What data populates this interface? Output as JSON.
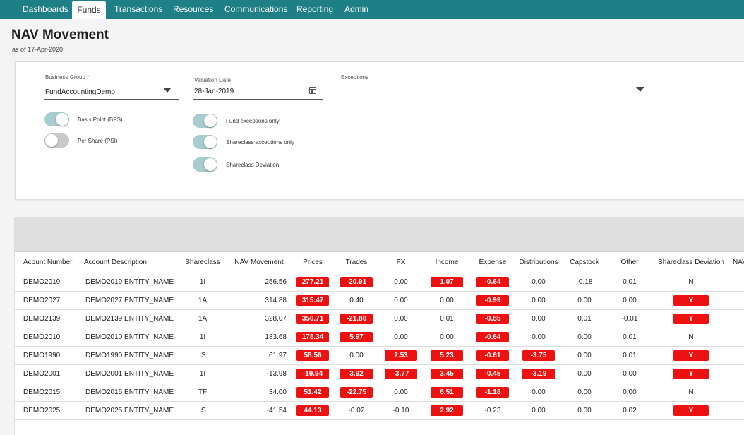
{
  "nav": {
    "tabs": [
      {
        "label": "Dashboards"
      },
      {
        "label": "Funds"
      },
      {
        "label": "Transactions"
      },
      {
        "label": "Resources"
      },
      {
        "label": "Communications"
      },
      {
        "label": "Reporting"
      },
      {
        "label": "Admin"
      }
    ],
    "active_tab": "Funds"
  },
  "header": {
    "title": "NAV Movement",
    "as_of": "as of 17-Apr-2020"
  },
  "filters": {
    "business_group": {
      "label": "Business Group *",
      "value": "FundAccountingDemo"
    },
    "valuation_date": {
      "label": "Valuation Date",
      "value": "28-Jan-2019"
    },
    "exceptions": {
      "label": "Exceptions",
      "value": ""
    },
    "toggles": [
      {
        "label": "Basis Point (BPS)",
        "on": true
      },
      {
        "label": "Per Share (PSI)",
        "on": false
      },
      {
        "label": "Fund exceptions only",
        "on": true
      },
      {
        "label": "Shareclass exceptions only",
        "on": true
      },
      {
        "label": "Shareclass Deviation",
        "on": true
      }
    ]
  },
  "table": {
    "columns": [
      "Acount Number",
      "Account Description",
      "Shareclass",
      "NAV Movement",
      "Prices",
      "Trades",
      "FX",
      "Income",
      "Expense",
      "Distributions",
      "Capstock",
      "Other",
      "Shareclass Deviation",
      "NAV"
    ],
    "rows": [
      {
        "account": "DEMO2019",
        "description": "DEMO2019 ENTITY_NAME",
        "shareclass": "1I",
        "nav_movement": "256.56",
        "prices": "277.21",
        "trades": "-20.91",
        "fx": "0.00",
        "income": "1.07",
        "expense": "-0.64",
        "distributions": "0.00",
        "capstock": "-0.18",
        "other": "0.01",
        "deviation": "N"
      },
      {
        "account": "DEMO2027",
        "description": "DEMO2027 ENTITY_NAME",
        "shareclass": "1A",
        "nav_movement": "314.88",
        "prices": "315.47",
        "trades": "0.40",
        "fx": "0.00",
        "income": "0.00",
        "expense": "-0.99",
        "distributions": "0.00",
        "capstock": "0.00",
        "other": "0.00",
        "deviation": "Y"
      },
      {
        "account": "DEMO2139",
        "description": "DEMO2139 ENTITY_NAME",
        "shareclass": "1A",
        "nav_movement": "328.07",
        "prices": "350.71",
        "trades": "-21.80",
        "fx": "0.00",
        "income": "0.01",
        "expense": "-0.85",
        "distributions": "0.00",
        "capstock": "0.01",
        "other": "-0.01",
        "deviation": "Y"
      },
      {
        "account": "DEMO2010",
        "description": "DEMO2010 ENTITY_NAME",
        "shareclass": "1I",
        "nav_movement": "183.68",
        "prices": "178.34",
        "trades": "5.97",
        "fx": "0.00",
        "income": "0.00",
        "expense": "-0.64",
        "distributions": "0.00",
        "capstock": "0.00",
        "other": "0.01",
        "deviation": "N"
      },
      {
        "account": "DEMO1990",
        "description": "DEMO1990 ENTITY_NAME",
        "shareclass": "IS",
        "nav_movement": "61.97",
        "prices": "58.56",
        "trades": "0.00",
        "fx": "2.53",
        "income": "5.23",
        "expense": "-0.61",
        "distributions": "-3.75",
        "capstock": "0.00",
        "other": "0.01",
        "deviation": "Y"
      },
      {
        "account": "DEMO2001",
        "description": "DEMO2001 ENTITY_NAME",
        "shareclass": "1I",
        "nav_movement": "-13.98",
        "prices": "-19.94",
        "trades": "3.92",
        "fx": "-3.77",
        "income": "3.45",
        "expense": "-0.45",
        "distributions": "-3.19",
        "capstock": "0.00",
        "other": "0.00",
        "deviation": "Y"
      },
      {
        "account": "DEMO2015",
        "description": "DEMO2015 ENTITY_NAME",
        "shareclass": "TF",
        "nav_movement": "34.00",
        "prices": "51.42",
        "trades": "-22.75",
        "fx": "0.00",
        "income": "6.51",
        "expense": "-1.18",
        "distributions": "0.00",
        "capstock": "0.00",
        "other": "0.00",
        "deviation": "N"
      },
      {
        "account": "DEMO2025",
        "description": "DEMO2025 ENTITY_NAME",
        "shareclass": "IS",
        "nav_movement": "-41.54",
        "prices": "44.13",
        "trades": "-0.02",
        "fx": "-0.10",
        "income": "2.92",
        "expense": "-0.23",
        "distributions": "0.00",
        "capstock": "0.00",
        "other": "0.02",
        "deviation": "Y"
      }
    ],
    "highlighted": [
      [
        "prices",
        "trades",
        "income",
        "expense"
      ],
      [
        "prices",
        "expense",
        "deviation"
      ],
      [
        "prices",
        "trades",
        "expense",
        "deviation"
      ],
      [
        "prices",
        "trades",
        "expense"
      ],
      [
        "prices",
        "fx",
        "income",
        "expense",
        "distributions",
        "deviation"
      ],
      [
        "prices",
        "trades",
        "fx",
        "income",
        "expense",
        "distributions",
        "deviation"
      ],
      [
        "prices",
        "trades",
        "income",
        "expense"
      ],
      [
        "prices",
        "income",
        "deviation"
      ]
    ]
  },
  "colors": {
    "nav_bar": "#1f7f86",
    "highlight": "#ee1111",
    "toggle_on": "#a8cccf",
    "toggle_off": "#c9c9c9"
  }
}
